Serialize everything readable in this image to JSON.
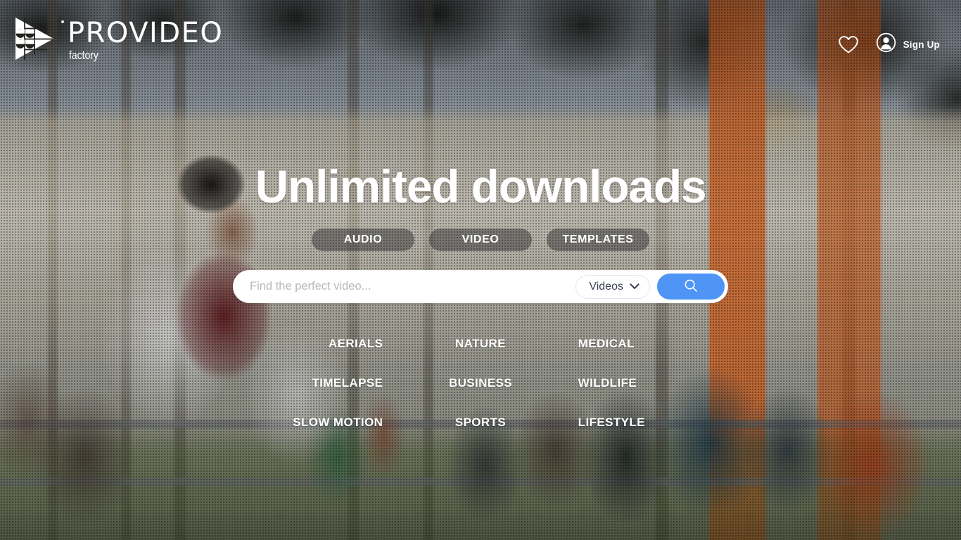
{
  "brand": {
    "logo_icon": "play-triangle-logo",
    "name": "PROVIDEO",
    "tagline": "factory",
    "registered_mark": "®"
  },
  "header": {
    "favorites_icon": "heart-icon",
    "account_icon": "user-avatar-icon",
    "signup_label": "Sign Up"
  },
  "hero": {
    "headline": "Unlimited downloads"
  },
  "tabs": [
    {
      "label": "AUDIO",
      "active": false
    },
    {
      "label": "VIDEO",
      "active": false
    },
    {
      "label": "TEMPLATES",
      "active": false
    }
  ],
  "search": {
    "placeholder": "Find the perfect video...",
    "value": "",
    "type_selected": "Videos",
    "type_options": [
      "Videos"
    ],
    "dropdown_icon": "chevron-down-icon",
    "submit_icon": "search-icon",
    "submit_color": "#4e95f5"
  },
  "categories": [
    {
      "label": "AERIALS",
      "column": 0
    },
    {
      "label": "NATURE",
      "column": 1
    },
    {
      "label": "MEDICAL",
      "column": 2
    },
    {
      "label": "TIMELAPSE",
      "column": 0
    },
    {
      "label": "BUSINESS",
      "column": 1
    },
    {
      "label": "WILDLIFE",
      "column": 2
    },
    {
      "label": "SLOW MOTION",
      "column": 0
    },
    {
      "label": "SPORTS",
      "column": 1
    },
    {
      "label": "LIFESTYLE",
      "column": 2
    }
  ],
  "colors": {
    "accent_blue": "#4e95f5",
    "text_on_dark": "#ffffff",
    "input_text": "#3b4354",
    "placeholder": "#b6b9bd"
  }
}
